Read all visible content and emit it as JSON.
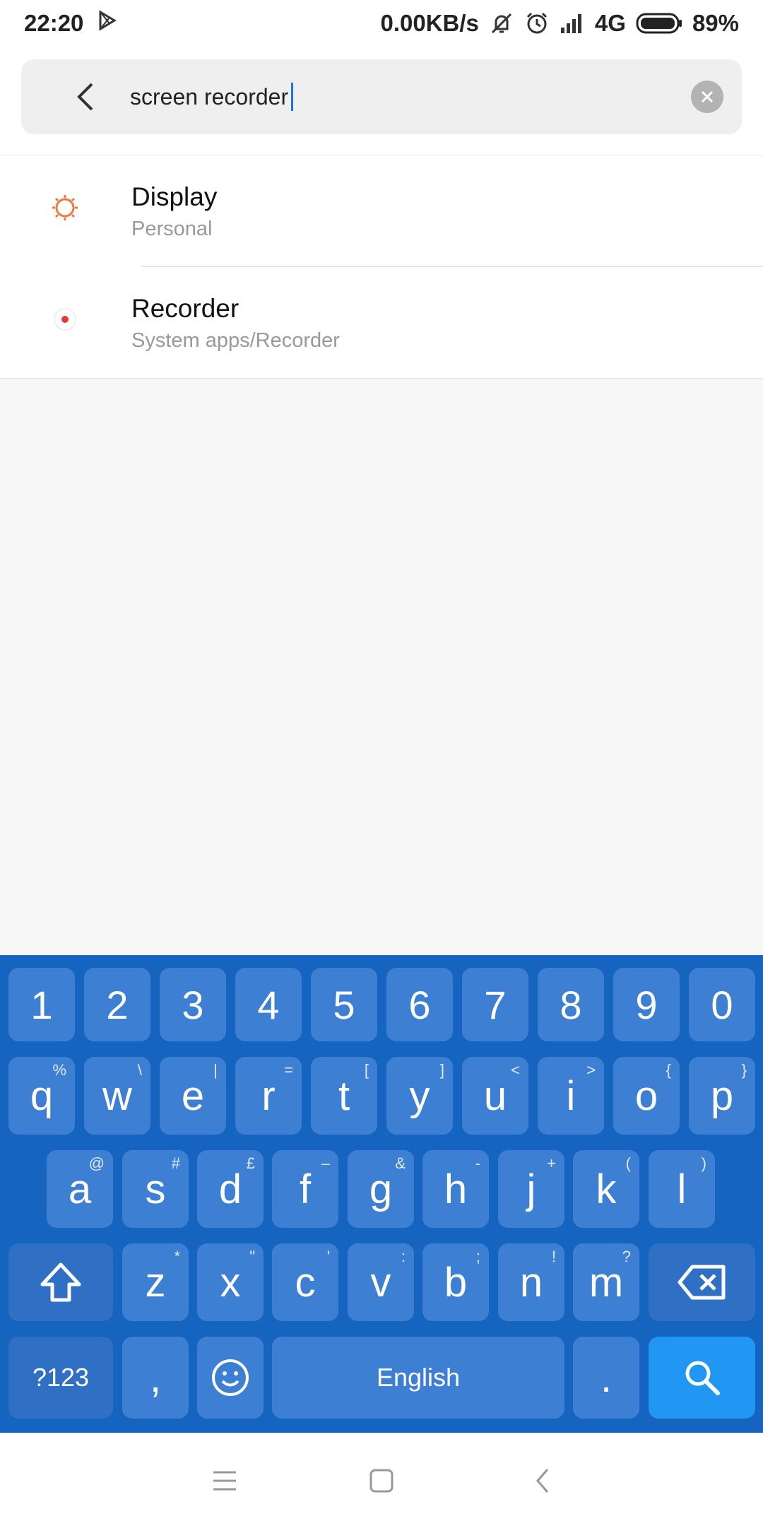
{
  "status_bar": {
    "time": "22:20",
    "network_speed": "0.00KB/s",
    "network_type": "4G",
    "battery": "89%",
    "icons": [
      "play-store-icon",
      "mute-icon",
      "alarm-icon",
      "signal-icon",
      "battery-icon"
    ]
  },
  "search": {
    "query": "screen recorder"
  },
  "results": [
    {
      "title": "Display",
      "subtitle": "Personal",
      "icon": "display-icon",
      "icon_color": "#f07a3e"
    },
    {
      "title": "Recorder",
      "subtitle": "System apps/Recorder",
      "icon": "recorder-icon",
      "icon_color": "#e53935"
    }
  ],
  "keyboard": {
    "row_numbers": [
      "1",
      "2",
      "3",
      "4",
      "5",
      "6",
      "7",
      "8",
      "9",
      "0"
    ],
    "row_q": [
      {
        "k": "q",
        "h": "%"
      },
      {
        "k": "w",
        "h": "\\"
      },
      {
        "k": "e",
        "h": "|"
      },
      {
        "k": "r",
        "h": "="
      },
      {
        "k": "t",
        "h": "["
      },
      {
        "k": "y",
        "h": "]"
      },
      {
        "k": "u",
        "h": "<"
      },
      {
        "k": "i",
        "h": ">"
      },
      {
        "k": "o",
        "h": "{"
      },
      {
        "k": "p",
        "h": "}"
      }
    ],
    "row_a": [
      {
        "k": "a",
        "h": "@"
      },
      {
        "k": "s",
        "h": "#"
      },
      {
        "k": "d",
        "h": "£"
      },
      {
        "k": "f",
        "h": "–"
      },
      {
        "k": "g",
        "h": "&"
      },
      {
        "k": "h",
        "h": "-"
      },
      {
        "k": "j",
        "h": "+"
      },
      {
        "k": "k",
        "h": "("
      },
      {
        "k": "l",
        "h": ")"
      }
    ],
    "row_z": [
      {
        "k": "z",
        "h": "*"
      },
      {
        "k": "x",
        "h": "\""
      },
      {
        "k": "c",
        "h": "'"
      },
      {
        "k": "v",
        "h": ":"
      },
      {
        "k": "b",
        "h": ";"
      },
      {
        "k": "n",
        "h": "!"
      },
      {
        "k": "m",
        "h": "?"
      }
    ],
    "symbols_label": "?123",
    "comma": ",",
    "space_label": "English",
    "period": ".",
    "colors": {
      "background": "#1565c0",
      "key": "#3d7fd2",
      "action": "#2196f3"
    }
  }
}
